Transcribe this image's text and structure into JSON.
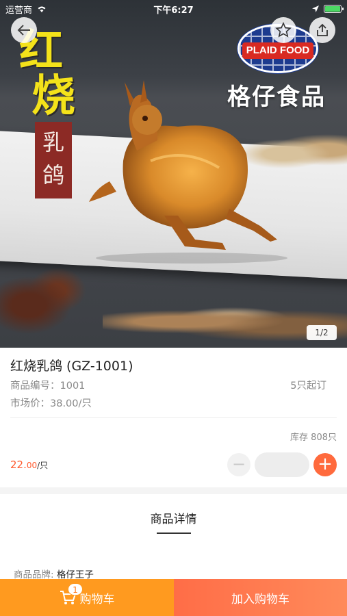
{
  "status_bar": {
    "carrier": "运营商",
    "time": "下午6:27"
  },
  "hero": {
    "calligraphy": [
      "红",
      "烧"
    ],
    "seal": [
      "乳",
      "鸽"
    ],
    "brand_logo_text": "PLAID FOOD",
    "brand_cn": "格仔食品",
    "pager": "1/2"
  },
  "product": {
    "title": "红烧乳鸽 (GZ-1001)",
    "code": "商品编号：1001",
    "market_price": "市场价：38.00/只",
    "moq": "5只起订",
    "stock": "库存 808只",
    "price_int": "22.",
    "price_dec": "00",
    "price_unit": "/只",
    "minus": "−",
    "plus": "+"
  },
  "detail": {
    "title": "商品详情",
    "brand_label": "商品品牌: ",
    "brand_value": "格仔王子"
  },
  "bottom": {
    "cart_label": "购物车",
    "cart_count": "1",
    "add_label": "加入购物车"
  },
  "colors": {
    "accent": "#ff6a3d",
    "cart": "#ff9a1f",
    "price": "#ff5a2e"
  }
}
